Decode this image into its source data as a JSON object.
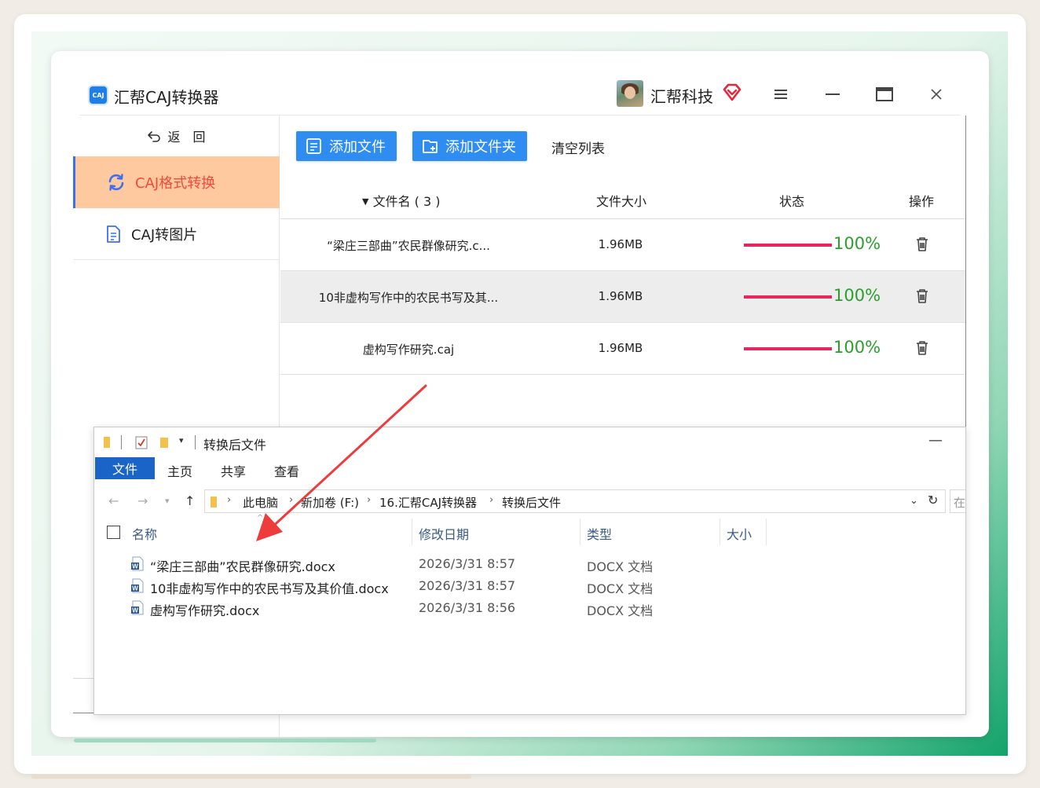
{
  "app": {
    "title": "汇帮CAJ转换器",
    "logo_text": "CAJ",
    "user_name": "汇帮科技"
  },
  "sidebar": {
    "back_label": "返　回",
    "items": [
      {
        "label": "CAJ格式转换",
        "active": true
      },
      {
        "label": "CAJ转图片",
        "active": false
      }
    ]
  },
  "toolbar": {
    "add_file_label": "添加文件",
    "add_folder_label": "添加文件夹",
    "clear_label": "清空列表"
  },
  "table": {
    "headers": {
      "name": "文件名 ( 3 )",
      "size": "文件大小",
      "status": "状态",
      "action": "操作"
    },
    "rows": [
      {
        "name": "“梁庄三部曲”农民群像研究.c...",
        "size": "1.96MB",
        "progress": 100,
        "progress_text": "100%"
      },
      {
        "name": "10非虚构写作中的农民书写及其...",
        "size": "1.96MB",
        "progress": 100,
        "progress_text": "100%"
      },
      {
        "name": "虚构写作研究.caj",
        "size": "1.96MB",
        "progress": 100,
        "progress_text": "100%"
      }
    ]
  },
  "explorer": {
    "title": "转换后文件",
    "ribbon_tabs": [
      "文件",
      "主页",
      "共享",
      "查看"
    ],
    "breadcrumb": [
      "此电脑",
      "新加卷 (F:)",
      "16.汇帮CAJ转换器",
      "转换后文件"
    ],
    "search_placeholder": "在",
    "columns": {
      "name": "名称",
      "modified": "修改日期",
      "type": "类型",
      "size": "大小"
    },
    "files": [
      {
        "name": "“梁庄三部曲”农民群像研究.docx",
        "modified": "2026/3/31 8:57",
        "type": "DOCX 文档"
      },
      {
        "name": "10非虚构写作中的农民书写及其价值.docx",
        "modified": "2026/3/31 8:57",
        "type": "DOCX 文档"
      },
      {
        "name": "虚构写作研究.docx",
        "modified": "2026/3/31 8:56",
        "type": "DOCX 文档"
      }
    ]
  },
  "colors": {
    "accent_blue": "#2f8df2",
    "active_nav_bg": "#ffc9a0",
    "active_nav_text": "#f24a3a",
    "progress_fill": "#e8265e",
    "progress_text": "#2aa02a",
    "arrow_red": "#ee3b3b"
  }
}
